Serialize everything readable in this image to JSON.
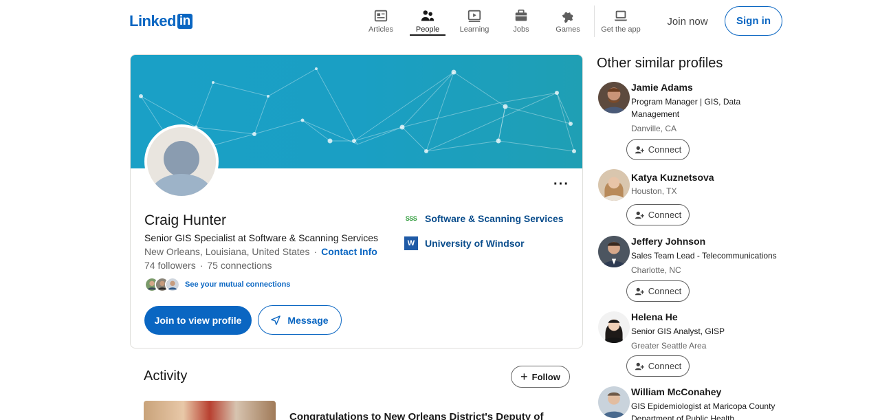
{
  "header": {
    "logo_text": "Linked",
    "logo_box": "in",
    "nav": [
      {
        "label": "Articles",
        "icon": "articles-icon"
      },
      {
        "label": "People",
        "icon": "people-icon",
        "active": true
      },
      {
        "label": "Learning",
        "icon": "learning-icon"
      },
      {
        "label": "Jobs",
        "icon": "briefcase-icon"
      },
      {
        "label": "Games",
        "icon": "puzzle-icon"
      },
      {
        "label": "Get the app",
        "icon": "laptop-icon"
      }
    ],
    "join_now": "Join now",
    "sign_in": "Sign in"
  },
  "profile": {
    "name": "Craig Hunter",
    "headline": "Senior GIS Specialist at Software & Scanning Services",
    "location": "New Orleans, Louisiana, United States",
    "separator": "·",
    "contact_info": "Contact Info",
    "followers": "74 followers",
    "connections": "75 connections",
    "mutual_link": "See your mutual connections",
    "join_button": "Join to view profile",
    "message_button": "Message",
    "more_menu": "···",
    "orgs": [
      {
        "logo_text": "SSS",
        "name": "Software & Scanning Services"
      },
      {
        "logo_text": "W",
        "name": "University of Windsor"
      }
    ]
  },
  "activity": {
    "title": "Activity",
    "follow_button": "Follow",
    "follow_plus": "+",
    "first_post_headline": "Congratulations to New Orleans District's Deputy of"
  },
  "rail": {
    "title": "Other similar profiles",
    "connect_label": "Connect",
    "people": [
      {
        "name": "Jamie Adams",
        "title": "Program Manager | GIS, Data Management",
        "location": "Danville, CA"
      },
      {
        "name": "Katya Kuznetsova",
        "title": "",
        "location": "Houston, TX"
      },
      {
        "name": "Jeffery Johnson",
        "title": "Sales Team Lead - Telecommunications",
        "location": "Charlotte, NC"
      },
      {
        "name": "Helena He",
        "title": "Senior GIS Analyst, GISP",
        "location": "Greater Seattle Area"
      },
      {
        "name": "William McConahey",
        "title": "GIS Epidemiologist at Maricopa County Department of Public Health",
        "location": ""
      }
    ]
  },
  "colors": {
    "brand_blue": "#0a66c2",
    "banner_teal": "#1aa0c6"
  }
}
